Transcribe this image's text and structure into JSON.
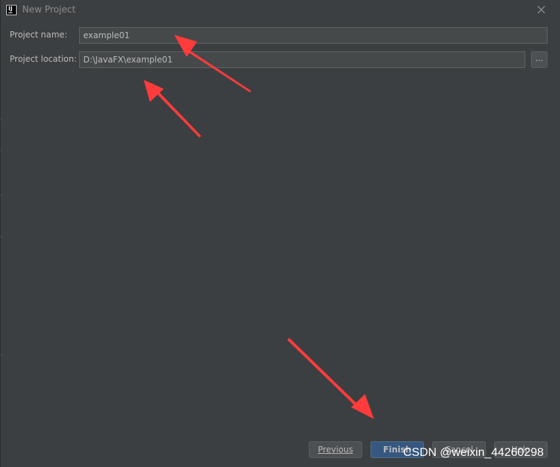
{
  "window": {
    "title": "New Project",
    "app_icon_text": "IJ"
  },
  "form": {
    "name_label": "Project name:",
    "name_value": "example01",
    "location_label": "Project location:",
    "location_value": "D:\\JavaFX\\example01",
    "browse_label": "..."
  },
  "buttons": {
    "previous": "Previous",
    "finish": "Finish",
    "cancel": "Cancel",
    "help": "Help"
  },
  "watermark": "CSDN @weixin_44260298",
  "colors": {
    "background": "#3c3f41",
    "input_background": "#45494a",
    "primary_button": "#365880",
    "annotation_arrow": "#ff3b3b"
  }
}
